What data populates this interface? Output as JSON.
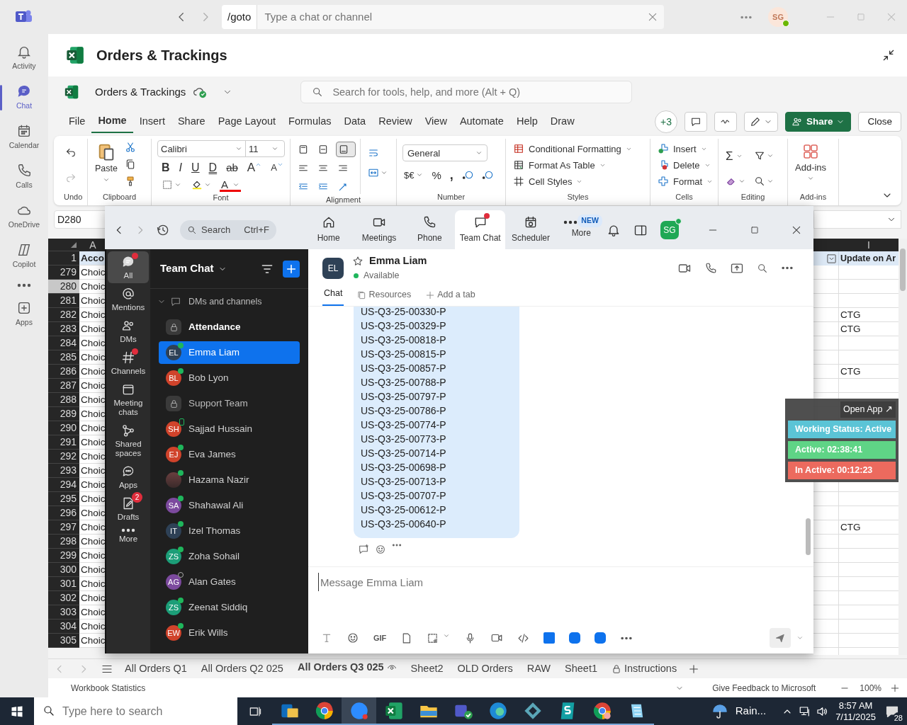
{
  "teams": {
    "search_prefix": "/goto",
    "search_placeholder": "Type a chat or channel",
    "avatar": "SG",
    "rail": [
      {
        "label": "Activity",
        "selected": false
      },
      {
        "label": "Chat",
        "selected": true
      },
      {
        "label": "Calendar",
        "selected": false
      },
      {
        "label": "Calls",
        "selected": false
      },
      {
        "label": "OneDrive",
        "selected": false
      },
      {
        "label": "Copilot",
        "selected": false
      }
    ],
    "rail_apps": "Apps"
  },
  "excel": {
    "title": "Orders & Trackings",
    "file_name": "Orders & Trackings",
    "search_placeholder": "Search for tools, help, and more (Alt + Q)",
    "menu": [
      {
        "label": "File",
        "selected": false
      },
      {
        "label": "Home",
        "selected": true
      },
      {
        "label": "Insert",
        "selected": false
      },
      {
        "label": "Share",
        "selected": false
      },
      {
        "label": "Page Layout",
        "selected": false
      },
      {
        "label": "Formulas",
        "selected": false
      },
      {
        "label": "Data",
        "selected": false
      },
      {
        "label": "Review",
        "selected": false
      },
      {
        "label": "View",
        "selected": false
      },
      {
        "label": "Automate",
        "selected": false
      },
      {
        "label": "Help",
        "selected": false
      },
      {
        "label": "Draw",
        "selected": false
      }
    ],
    "coauthors": "+3",
    "share": "Share",
    "close": "Close",
    "ribbon": {
      "undo": {
        "label": "Undo"
      },
      "clipboard": {
        "label": "Clipboard",
        "paste": "Paste"
      },
      "font": {
        "label": "Font",
        "family": "Calibri",
        "size": "11",
        "bold": "B",
        "italic": "I",
        "underline": "U",
        "double_underline": "D",
        "strike": "ab",
        "grow": "A",
        "shrink": "A",
        "font_color": "A"
      },
      "alignment": {
        "label": "Alignment"
      },
      "number": {
        "label": "Number",
        "format": "General",
        "currency": "$€",
        "percent": "%",
        "comma": ","
      },
      "styles": {
        "label": "Styles",
        "items": [
          "Conditional Formatting",
          "Format As Table",
          "Cell Styles"
        ]
      },
      "cells": {
        "label": "Cells",
        "items": [
          "Insert",
          "Delete",
          "Format"
        ]
      },
      "editing": {
        "label": "Editing",
        "sum": "Σ"
      },
      "addins": {
        "label": "Add-ins",
        "button": "Add-ins"
      }
    },
    "name_box": "D280",
    "grid": {
      "column_headers": {
        "a": "A",
        "i": "I"
      },
      "header_row": {
        "number": "1",
        "column_a": "Acco",
        "column_i": "Update on Ar"
      },
      "rows": [
        {
          "number": "279",
          "column_a": "Choic",
          "selected": false
        },
        {
          "number": "280",
          "column_a": "Choic",
          "selected": true
        },
        {
          "number": "281",
          "column_a": "Choic",
          "selected": false
        },
        {
          "number": "282",
          "column_a": "Choic",
          "column_i": "CTG",
          "selected": false
        },
        {
          "number": "283",
          "column_a": "Choic",
          "column_i": "CTG",
          "selected": false
        },
        {
          "number": "284",
          "column_a": "Choic",
          "selected": false
        },
        {
          "number": "285",
          "column_a": "Choic",
          "selected": false
        },
        {
          "number": "286",
          "column_a": "Choic",
          "column_i": "CTG",
          "selected": false
        },
        {
          "number": "287",
          "column_a": "Choic",
          "selected": false
        },
        {
          "number": "288",
          "column_a": "Choic",
          "selected": false
        },
        {
          "number": "289",
          "column_a": "Choic",
          "selected": false
        },
        {
          "number": "290",
          "column_a": "Choic",
          "selected": false
        },
        {
          "number": "291",
          "column_a": "Choic",
          "selected": false
        },
        {
          "number": "292",
          "column_a": "Choic",
          "selected": false
        },
        {
          "number": "293",
          "column_a": "Choic",
          "selected": false
        },
        {
          "number": "294",
          "column_a": "Choic",
          "selected": false
        },
        {
          "number": "295",
          "column_a": "Choic",
          "selected": false
        },
        {
          "number": "296",
          "column_a": "Choic",
          "selected": false
        },
        {
          "number": "297",
          "column_a": "Choic",
          "column_i": "CTG",
          "selected": false
        },
        {
          "number": "298",
          "column_a": "Choic",
          "selected": false
        },
        {
          "number": "299",
          "column_a": "Choic",
          "selected": false
        },
        {
          "number": "300",
          "column_a": "Choic",
          "selected": false
        },
        {
          "number": "301",
          "column_a": "Choic",
          "selected": false
        },
        {
          "number": "302",
          "column_a": "Choic",
          "selected": false
        },
        {
          "number": "303",
          "column_a": "Choic",
          "selected": false
        },
        {
          "number": "304",
          "column_a": "Choic",
          "selected": false
        },
        {
          "number": "305",
          "column_a": "Choic",
          "selected": false
        }
      ]
    },
    "sheets": [
      {
        "label": "All Orders Q1",
        "selected": false,
        "kind": "plain"
      },
      {
        "label": "All Orders Q2 025",
        "selected": false,
        "kind": "plain"
      },
      {
        "label": "All Orders Q3 025",
        "selected": true,
        "kind": "viewed"
      },
      {
        "label": "Sheet2",
        "selected": false,
        "kind": "plain"
      },
      {
        "label": "OLD Orders",
        "selected": false,
        "kind": "plain"
      },
      {
        "label": "RAW",
        "selected": false,
        "kind": "plain"
      },
      {
        "label": "Sheet1",
        "selected": false,
        "kind": "plain"
      },
      {
        "label": "Instructions",
        "selected": false,
        "kind": "locked"
      }
    ],
    "status": {
      "left": "Workbook Statistics",
      "feedback": "Give Feedback to Microsoft",
      "zoom": "100%"
    }
  },
  "zoom": {
    "search": "Search",
    "search_shortcut": "Ctrl+F",
    "tabs": [
      {
        "label": "Home",
        "selected": false,
        "dot": false
      },
      {
        "label": "Meetings",
        "selected": false,
        "dot": false
      },
      {
        "label": "Phone",
        "selected": false,
        "dot": false
      },
      {
        "label": "Team Chat",
        "selected": true,
        "dot": true
      },
      {
        "label": "Scheduler",
        "selected": false,
        "dot": false
      },
      {
        "label": "More",
        "selected": false,
        "dot": false,
        "badge": "NEW"
      }
    ],
    "avatar": "SG",
    "rail": [
      {
        "label": "All",
        "selected": true,
        "dot": true
      },
      {
        "label": "Mentions",
        "selected": false,
        "dot": false
      },
      {
        "label": "DMs",
        "selected": false,
        "dot": false
      },
      {
        "label": "Channels",
        "selected": false,
        "dot": true
      },
      {
        "label": "Meeting chats",
        "selected": false,
        "dot": false
      },
      {
        "label": "Shared spaces",
        "selected": false,
        "dot": false
      },
      {
        "label": "Apps",
        "selected": false,
        "dot": false
      },
      {
        "label": "Drafts",
        "selected": false,
        "dot": false,
        "badge": "2"
      },
      {
        "label": "More",
        "selected": false,
        "dot": false
      }
    ],
    "list_title": "Team Chat",
    "section": "DMs and channels",
    "chats": [
      {
        "name": "Attendance",
        "kind": "channel",
        "online": false,
        "on_mobile": false,
        "unread": true,
        "selected": false
      },
      {
        "name": "Emma Liam",
        "kind": "person",
        "initials": "EL",
        "color": "#2e4156",
        "online": true,
        "on_mobile": false,
        "unread": false,
        "selected": true
      },
      {
        "name": "Bob Lyon",
        "kind": "person",
        "initials": "BL",
        "color": "#d0432b",
        "online": true,
        "on_mobile": false,
        "unread": false,
        "selected": false
      },
      {
        "name": "Support Team",
        "kind": "channel",
        "online": false,
        "on_mobile": false,
        "unread": false,
        "selected": false
      },
      {
        "name": "Sajjad Hussain",
        "kind": "person",
        "initials": "SH",
        "color": "#d0432b",
        "online": true,
        "on_mobile": true,
        "unread": false,
        "selected": false
      },
      {
        "name": "Eva James",
        "kind": "person",
        "initials": "EJ",
        "color": "#d0432b",
        "online": true,
        "on_mobile": false,
        "unread": false,
        "selected": false
      },
      {
        "name": "Hazama Nazir",
        "kind": "photo",
        "online": true,
        "on_mobile": false,
        "unread": false,
        "selected": false
      },
      {
        "name": "Shahawal Ali",
        "kind": "person",
        "initials": "SA",
        "color": "#7c4a9e",
        "online": true,
        "on_mobile": false,
        "unread": false,
        "selected": false
      },
      {
        "name": "Izel Thomas",
        "kind": "person",
        "initials": "IT",
        "color": "#2e4156",
        "online": true,
        "on_mobile": false,
        "unread": false,
        "selected": false
      },
      {
        "name": "Zoha Sohail",
        "kind": "person",
        "initials": "ZS",
        "color": "#1c9e78",
        "online": true,
        "on_mobile": false,
        "unread": false,
        "selected": false
      },
      {
        "name": "Alan Gates",
        "kind": "person",
        "initials": "AG",
        "color": "#7c4a9e",
        "online": false,
        "on_mobile": false,
        "unread": false,
        "selected": false
      },
      {
        "name": "Zeenat Siddiq",
        "kind": "person",
        "initials": "ZS",
        "color": "#1c9e78",
        "online": true,
        "on_mobile": false,
        "unread": false,
        "selected": false
      },
      {
        "name": "Erik Wills",
        "kind": "person",
        "initials": "EW",
        "color": "#d0432b",
        "online": true,
        "on_mobile": false,
        "unread": false,
        "selected": false
      }
    ],
    "contact": {
      "initials": "EL",
      "name": "Emma Liam",
      "status": "Available"
    },
    "conv_tabs": [
      {
        "label": "Chat",
        "selected": true
      },
      {
        "label": "Resources",
        "selected": false
      },
      {
        "label": "Add a tab",
        "selected": false
      }
    ],
    "message_lines": [
      "US-Q3-25-00330-P",
      "US-Q3-25-00329-P",
      "US-Q3-25-00818-P",
      "US-Q3-25-00815-P",
      "US-Q3-25-00857-P",
      "US-Q3-25-00788-P",
      "US-Q3-25-00797-P",
      "US-Q3-25-00786-P",
      "US-Q3-25-00774-P",
      "US-Q3-25-00773-P",
      "US-Q3-25-00714-P",
      "US-Q3-25-00698-P",
      "US-Q3-25-00713-P",
      "US-Q3-25-00707-P",
      "US-Q3-25-00612-P",
      "US-Q3-25-00640-P"
    ],
    "composer_placeholder": "Message Emma Liam",
    "gif": "GIF"
  },
  "tracker": {
    "open_app": "Open App ↗",
    "rows": [
      {
        "label": "Working Status: Active",
        "color": "#5bc4d6"
      },
      {
        "label": "Active: 02:38:41",
        "color": "#5fd486"
      },
      {
        "label": "In Active: 00:12:23",
        "color": "#ec6a5e"
      }
    ]
  },
  "taskbar": {
    "search_placeholder": "Type here to search",
    "apps": [
      {
        "selected": false
      },
      {
        "selected": false
      },
      {
        "selected": true
      },
      {
        "selected": false
      },
      {
        "selected": false
      },
      {
        "selected": false
      },
      {
        "selected": false
      },
      {
        "selected": false
      },
      {
        "selected": false
      },
      {
        "selected": false
      },
      {
        "selected": false
      }
    ],
    "weather": "Rain...",
    "time": "8:57 AM",
    "date": "7/11/2025",
    "notifications": "28"
  }
}
